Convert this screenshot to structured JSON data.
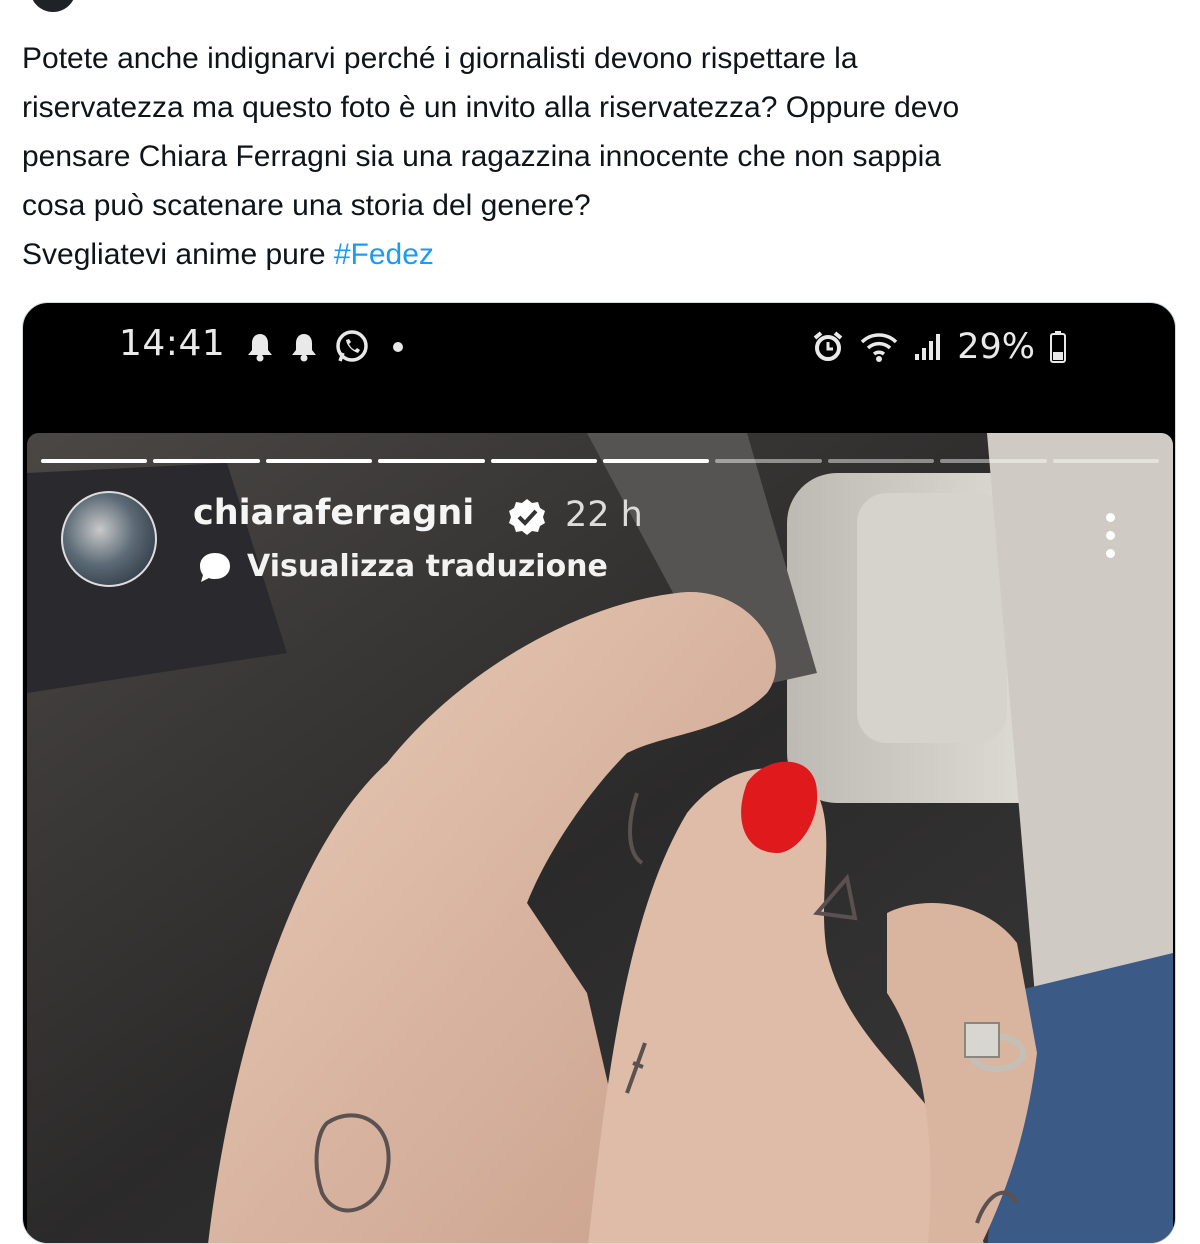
{
  "tweet": {
    "lines": [
      "Potete anche indignarvi perché i giornalisti devono rispettare la",
      "riservatezza ma questo foto è un invito alla riservatezza? Oppure devo",
      "pensare Chiara Ferragni sia una ragazzina innocente che non sappia",
      "cosa può scatenare una storia del genere?"
    ],
    "last_line_text": "Svegliatevi anime pure ",
    "hashtag": "#Fedez"
  },
  "phone_status": {
    "time": "14:41",
    "battery": "29%",
    "left_icons": [
      "bell-icon",
      "bell-icon",
      "whatsapp-icon",
      "dot-icon"
    ],
    "right_icons": [
      "alarm-icon",
      "wifi-icon",
      "signal-icon",
      "battery-icon"
    ]
  },
  "story": {
    "username": "chiaraferragni",
    "time_ago": "22 h",
    "translate_label": "Visualizza traduzione",
    "progress": {
      "segments": 10,
      "completed": 6
    }
  },
  "colors": {
    "hashtag": "#1d9bf0",
    "nail_polish": "#e0191c",
    "text": "#0f1419"
  }
}
